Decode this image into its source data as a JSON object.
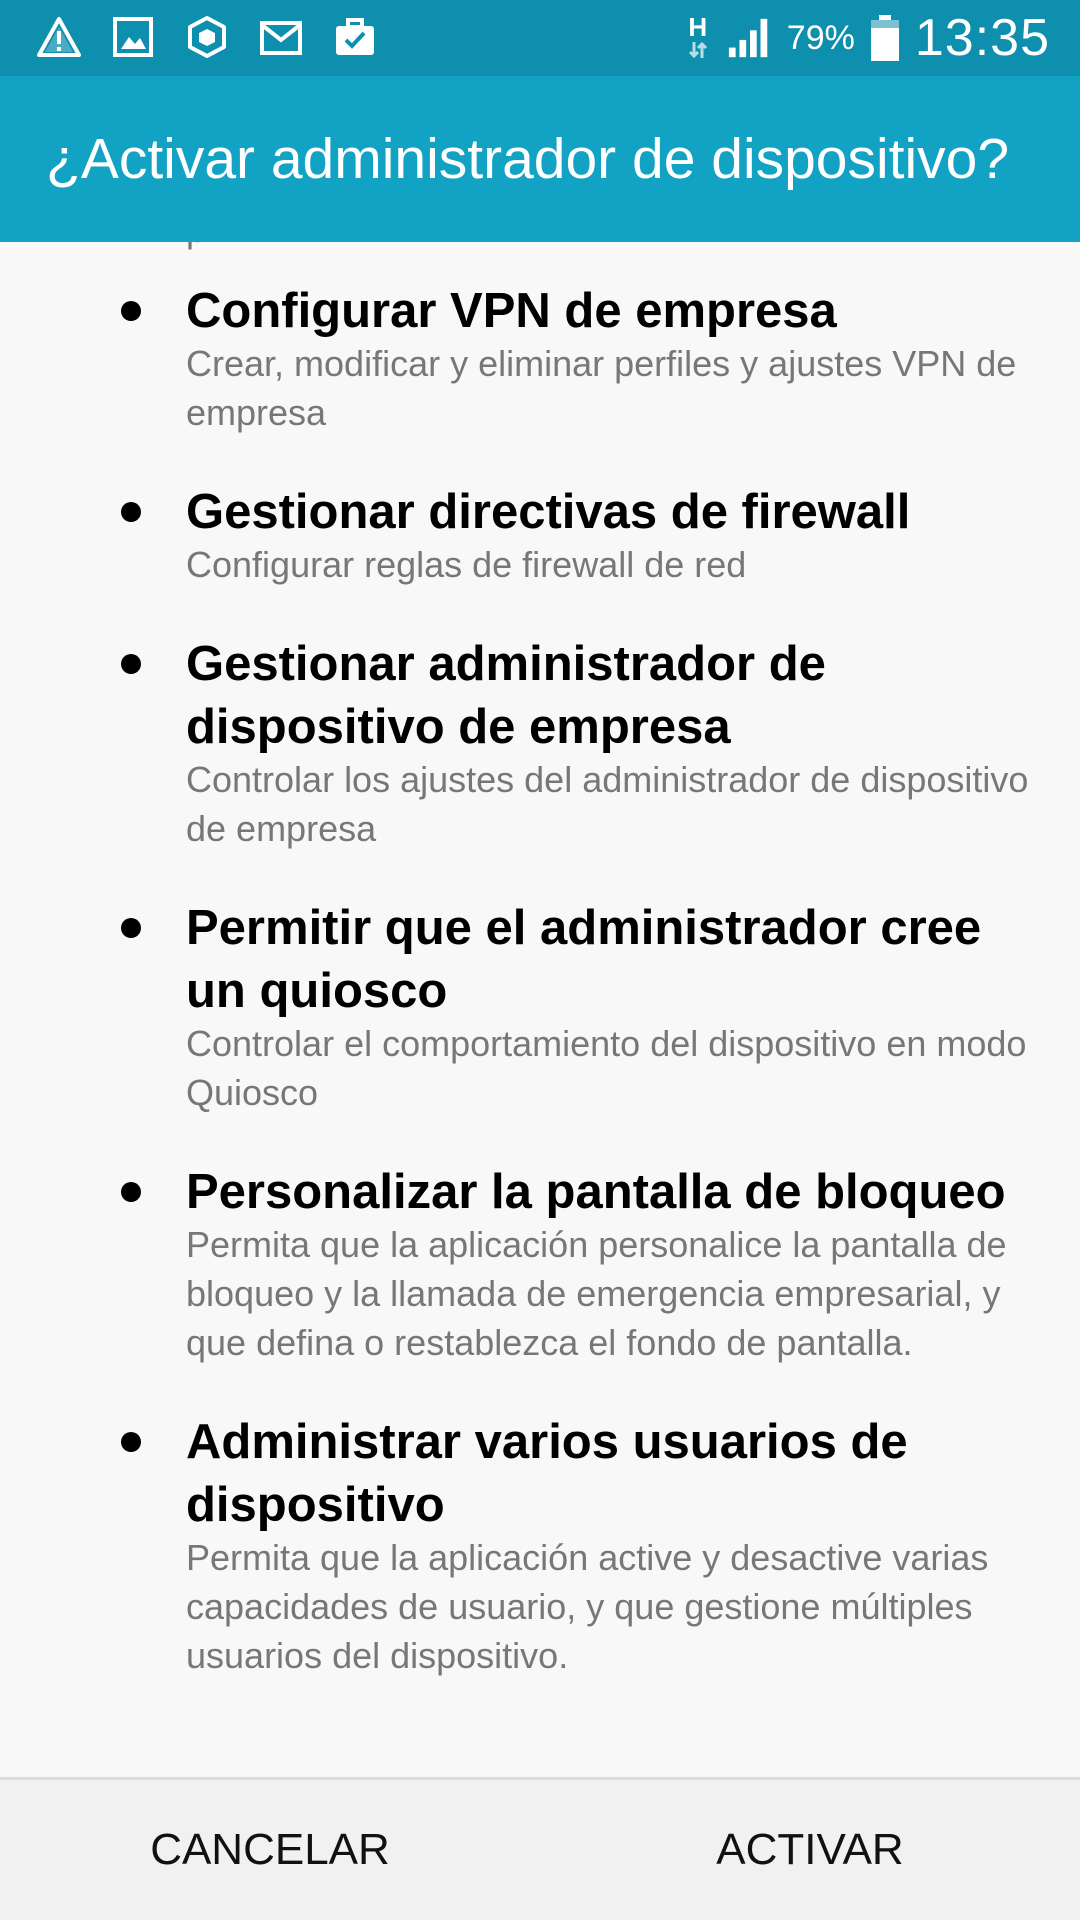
{
  "status_bar": {
    "notification_icons": [
      "warning-icon",
      "image-icon",
      "network-cube-icon",
      "email-icon",
      "briefcase-check-icon"
    ],
    "network_type": "H",
    "signal_icon": "signal-bars-icon",
    "battery_percent": "79%",
    "battery_icon": "battery-icon",
    "time": "13:35"
  },
  "app_bar": {
    "title": "¿Activar administrador de dispositivo?"
  },
  "permissions": [
    {
      "title": "Configurar VPN de empresa",
      "description": "Crear, modificar y eliminar perfiles y ajustes VPN de empresa"
    },
    {
      "title": "Gestionar directivas de firewall",
      "description": "Configurar reglas de firewall de red"
    },
    {
      "title": "Gestionar administrador de dispositivo de empresa",
      "description": "Controlar los ajustes del administrador de dispositivo de empresa"
    },
    {
      "title": "Permitir que el administrador cree un quiosco",
      "description": "Controlar el comportamiento del dispositivo en modo Quiosco"
    },
    {
      "title": "Personalizar la pantalla de bloqueo",
      "description": "Permita que la aplicación personalice la pantalla de bloqueo y la llamada de emergencia empresarial, y que defina o restablezca el fondo de pantalla."
    },
    {
      "title": "Administrar varios usuarios de dispositivo",
      "description": "Permita que la aplicación active y desactive varias capacidades de usuario, y que gestione múltiples usuarios del dispositivo."
    }
  ],
  "buttons": {
    "cancel": "CANCELAR",
    "activate": "ACTIVAR"
  },
  "colors": {
    "status_bar": "#0f8fae",
    "app_bar": "#12a3c4",
    "background": "#f8f8f8",
    "button_bar": "#f1f1f1",
    "description_text": "#777777"
  }
}
